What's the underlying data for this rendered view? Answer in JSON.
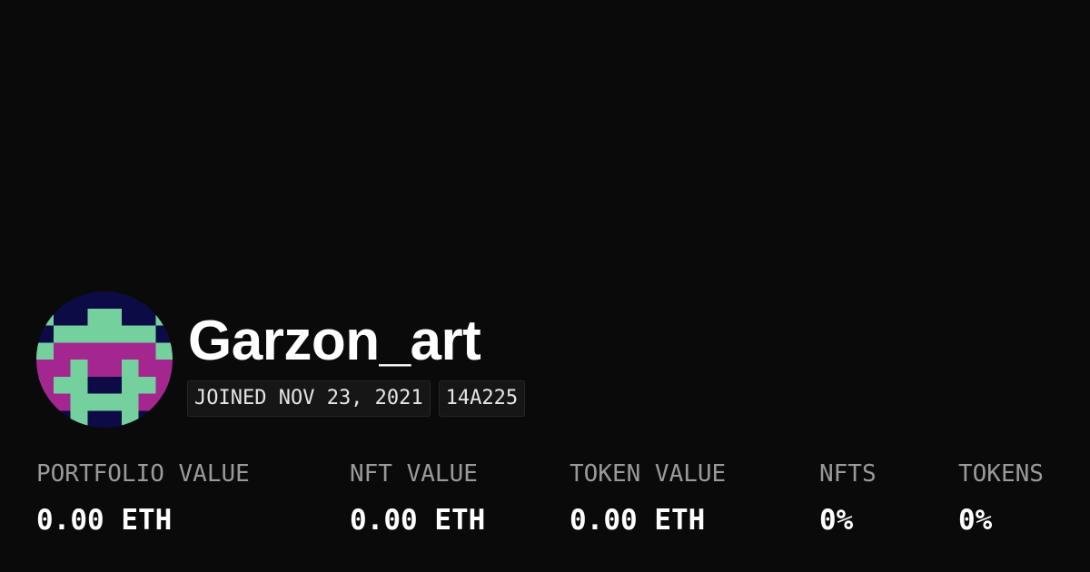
{
  "profile": {
    "username": "Garzon_art",
    "joined": "JOINED NOV 23, 2021",
    "address_short": "14A225",
    "avatar_colors": {
      "background": "#0d0b45",
      "primary": "#74d19e",
      "accent": "#a3278f"
    }
  },
  "stats": [
    {
      "label": "PORTFOLIO VALUE",
      "value": "0.00 ETH"
    },
    {
      "label": "NFT VALUE",
      "value": "0.00 ETH"
    },
    {
      "label": "TOKEN VALUE",
      "value": "0.00 ETH"
    },
    {
      "label": "NFTS",
      "value": "0%"
    },
    {
      "label": "TOKENS",
      "value": "0%"
    }
  ]
}
